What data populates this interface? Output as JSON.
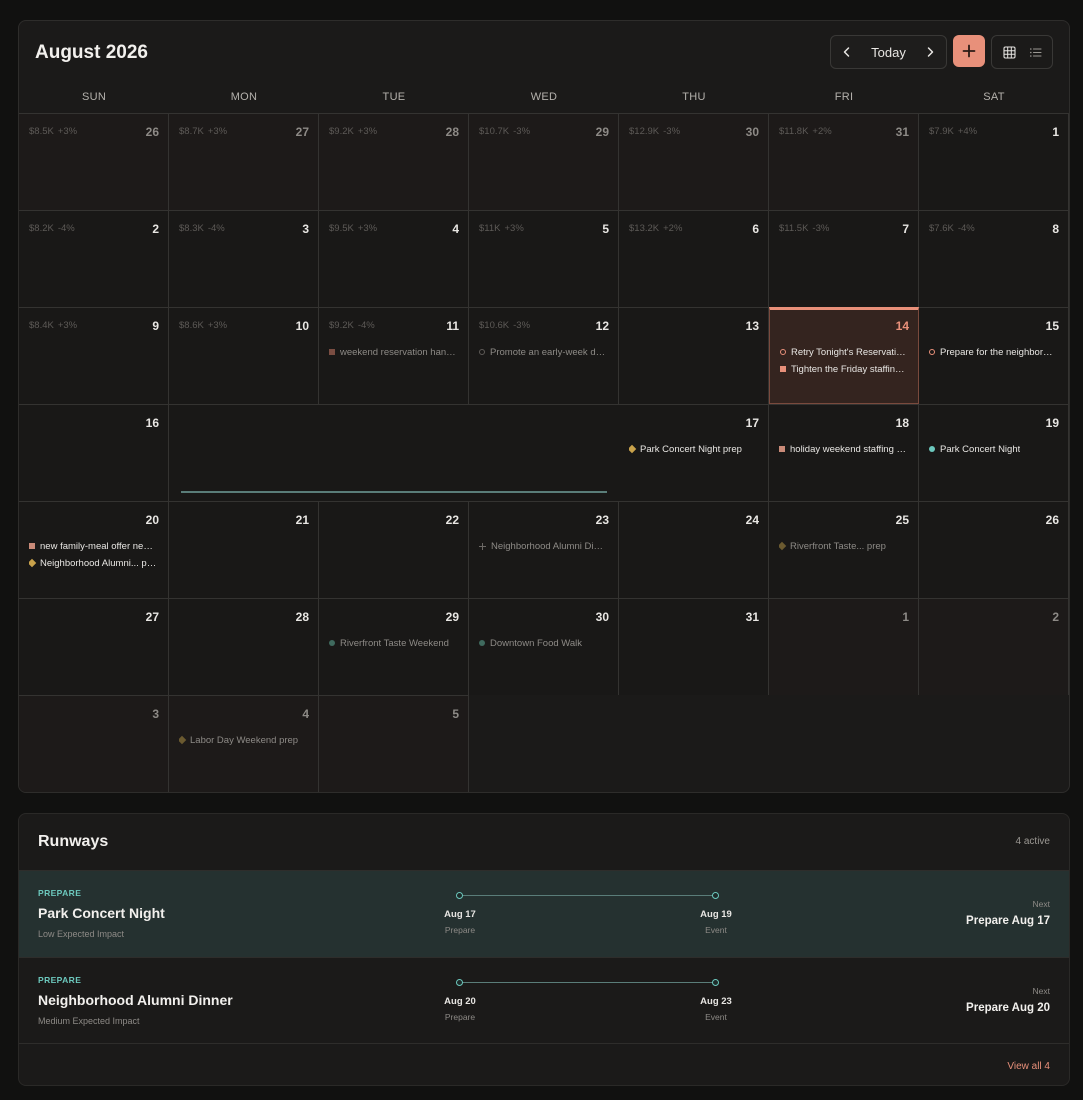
{
  "calendar": {
    "title": "August 2026",
    "today_label": "Today",
    "weekdays": [
      "SUN",
      "MON",
      "TUE",
      "WED",
      "THU",
      "FRI",
      "SAT"
    ],
    "weeks": [
      [
        {
          "day": "26",
          "rev": "$8.5K",
          "pct": "+3%"
        },
        {
          "day": "27",
          "rev": "$8.7K",
          "pct": "+3%"
        },
        {
          "day": "28",
          "rev": "$9.2K",
          "pct": "+3%"
        },
        {
          "day": "29",
          "rev": "$10.7K",
          "pct": "-3%"
        },
        {
          "day": "30",
          "rev": "$12.9K",
          "pct": "-3%"
        },
        {
          "day": "31",
          "rev": "$11.8K",
          "pct": "+2%"
        },
        {
          "day": "1",
          "rev": "$7.9K",
          "pct": "+4%"
        }
      ],
      [
        {
          "day": "2",
          "rev": "$8.2K",
          "pct": "-4%"
        },
        {
          "day": "3",
          "rev": "$8.3K",
          "pct": "-4%"
        },
        {
          "day": "4",
          "rev": "$9.5K",
          "pct": "+3%"
        },
        {
          "day": "5",
          "rev": "$11K",
          "pct": "+3%"
        },
        {
          "day": "6",
          "rev": "$13.2K",
          "pct": "+2%"
        },
        {
          "day": "7",
          "rev": "$11.5K",
          "pct": "-3%"
        },
        {
          "day": "8",
          "rev": "$7.6K",
          "pct": "-4%"
        }
      ],
      [
        {
          "day": "9",
          "rev": "$8.4K",
          "pct": "+3%"
        },
        {
          "day": "10",
          "rev": "$8.6K",
          "pct": "+3%"
        },
        {
          "day": "11",
          "rev": "$9.2K",
          "pct": "-4%",
          "events": [
            {
              "text": "weekend reservation handling",
              "marker": "sq",
              "color": "#7a4d42",
              "tone": "muted"
            }
          ]
        },
        {
          "day": "12",
          "rev": "$10.6K",
          "pct": "-3%",
          "events": [
            {
              "text": "Promote an early-week dinner",
              "marker": "ring",
              "color": "#5d5a57",
              "tone": "muted"
            }
          ]
        },
        {
          "day": "13"
        },
        {
          "day": "14",
          "events": [
            {
              "text": "Retry Tonight's Reservations",
              "marker": "ring",
              "color": "#e8907a",
              "tone": "bright"
            },
            {
              "text": "Tighten the Friday staffing plan",
              "marker": "sq",
              "color": "#e8907a",
              "tone": "bright"
            }
          ]
        },
        {
          "day": "15",
          "events": [
            {
              "text": "Prepare for the neighborhood event",
              "marker": "ring",
              "color": "#e8907a",
              "tone": "bright"
            }
          ]
        }
      ],
      [
        {
          "day": "16"
        },
        {
          "day": "17",
          "events": [
            {
              "text": "Park Concert Night prep",
              "marker": "dia",
              "color": "#c9a24b",
              "tone": "bright"
            }
          ]
        },
        {
          "day": "18",
          "events": [
            {
              "text": "holiday weekend staffing review",
              "marker": "sq",
              "color": "#c98a78",
              "tone": "bright"
            }
          ]
        },
        {
          "day": "19",
          "events": [
            {
              "text": "Park Concert Night",
              "marker": "dot",
              "color": "#6cc8bd",
              "tone": "bright"
            }
          ]
        }
      ],
      [
        {
          "day": "20",
          "events": [
            {
              "text": "new family-meal offer needs review",
              "marker": "sq",
              "color": "#c98a78",
              "tone": "bright"
            },
            {
              "text": "Neighborhood Alumni... prep",
              "marker": "dia",
              "color": "#c9a24b",
              "tone": "bright"
            }
          ]
        },
        {
          "day": "21"
        },
        {
          "day": "22"
        },
        {
          "day": "23",
          "events": [
            {
              "text": "Neighborhood Alumni Dinner",
              "marker": "plus",
              "color": "#6b6865",
              "tone": "muted"
            }
          ]
        },
        {
          "day": "24"
        },
        {
          "day": "25",
          "events": [
            {
              "text": "Riverfront Taste... prep",
              "marker": "dia",
              "color": "#6b5a30",
              "tone": "muted"
            }
          ]
        },
        {
          "day": "26"
        }
      ],
      [
        {
          "day": "27"
        },
        {
          "day": "28"
        },
        {
          "day": "29",
          "events": [
            {
              "text": "Riverfront Taste Weekend",
              "marker": "dot",
              "color": "#3f6a5e",
              "tone": "muted"
            }
          ]
        },
        {
          "day": "30",
          "events": [
            {
              "text": "Downtown Food Walk",
              "marker": "dot",
              "color": "#3f6a5e",
              "tone": "muted"
            }
          ]
        },
        {
          "day": "31"
        },
        {
          "day": "1"
        },
        {
          "day": "2"
        }
      ],
      [
        {
          "day": "3"
        },
        {
          "day": "4",
          "events": [
            {
              "text": "Labor Day Weekend prep",
              "marker": "dia",
              "color": "#6b5a30",
              "tone": "muted"
            }
          ]
        },
        {
          "day": "5"
        }
      ]
    ]
  },
  "runways": {
    "title": "Runways",
    "count": "4 active",
    "items": [
      {
        "stage": "PREPARE",
        "name": "Park Concert Night",
        "impact": "Low Expected Impact",
        "start_date": "Aug 17",
        "start_label": "Prepare",
        "end_date": "Aug 19",
        "end_label": "Event",
        "next_label": "Next",
        "next_value": "Prepare Aug 17"
      },
      {
        "stage": "PREPARE",
        "name": "Neighborhood Alumni Dinner",
        "impact": "Medium Expected Impact",
        "start_date": "Aug 20",
        "start_label": "Prepare",
        "end_date": "Aug 23",
        "end_label": "Event",
        "next_label": "Next",
        "next_value": "Prepare Aug 20"
      }
    ],
    "view_all": "View all 4"
  },
  "colors": {
    "accent": "#e8907a",
    "teal": "#6cc8bd"
  }
}
